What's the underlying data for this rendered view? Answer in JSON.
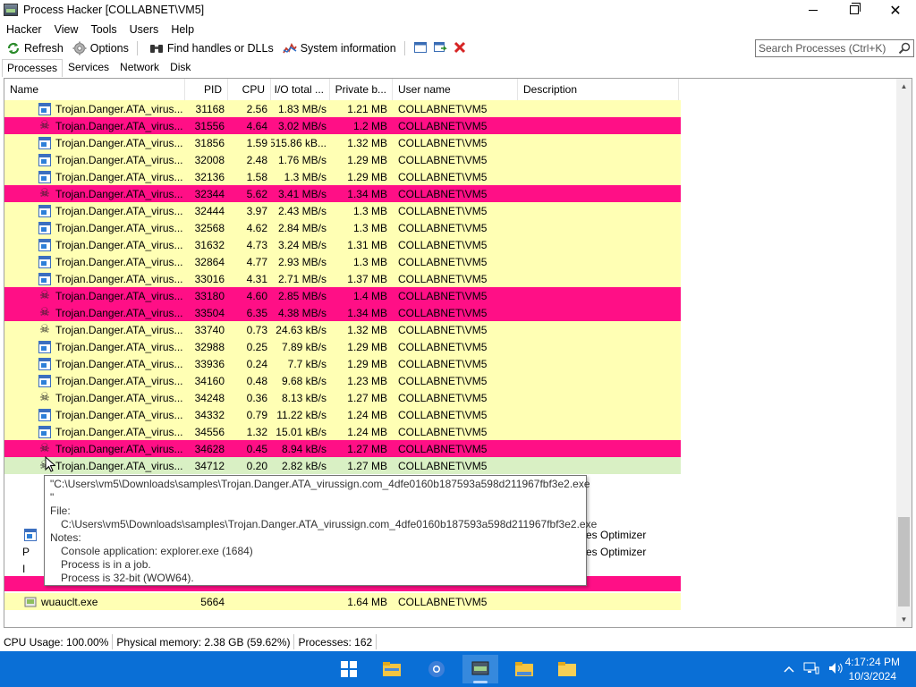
{
  "window": {
    "title": "Process Hacker [COLLABNET\\VM5]"
  },
  "menu": [
    "Hacker",
    "View",
    "Tools",
    "Users",
    "Help"
  ],
  "toolbar": {
    "refresh_label": "Refresh",
    "options_label": "Options",
    "find_label": "Find handles or DLLs",
    "sysinfo_label": "System information",
    "search_placeholder": "Search Processes (Ctrl+K)"
  },
  "tabs": [
    "Processes",
    "Services",
    "Network",
    "Disk"
  ],
  "columns": [
    "Name",
    "PID",
    "CPU",
    "I/O total ...",
    "Private b...",
    "User name",
    "Description"
  ],
  "rows": [
    {
      "name": "Trojan.Danger.ATA_virus...",
      "pid": "31168",
      "cpu": "2.56",
      "io": "1.83 MB/s",
      "priv": "1.21 MB",
      "user": "COLLABNET\\VM5",
      "color": "yellow",
      "icon": "window"
    },
    {
      "name": "Trojan.Danger.ATA_virus...",
      "pid": "31556",
      "cpu": "4.64",
      "io": "3.02 MB/s",
      "priv": "1.2 MB",
      "user": "COLLABNET\\VM5",
      "color": "magenta",
      "icon": "skull"
    },
    {
      "name": "Trojan.Danger.ATA_virus...",
      "pid": "31856",
      "cpu": "1.59",
      "io": "515.86 kB...",
      "priv": "1.32 MB",
      "user": "COLLABNET\\VM5",
      "color": "yellow",
      "icon": "window"
    },
    {
      "name": "Trojan.Danger.ATA_virus...",
      "pid": "32008",
      "cpu": "2.48",
      "io": "1.76 MB/s",
      "priv": "1.29 MB",
      "user": "COLLABNET\\VM5",
      "color": "yellow",
      "icon": "window"
    },
    {
      "name": "Trojan.Danger.ATA_virus...",
      "pid": "32136",
      "cpu": "1.58",
      "io": "1.3 MB/s",
      "priv": "1.29 MB",
      "user": "COLLABNET\\VM5",
      "color": "yellow",
      "icon": "window"
    },
    {
      "name": "Trojan.Danger.ATA_virus...",
      "pid": "32344",
      "cpu": "5.62",
      "io": "3.41 MB/s",
      "priv": "1.34 MB",
      "user": "COLLABNET\\VM5",
      "color": "magenta",
      "icon": "skull"
    },
    {
      "name": "Trojan.Danger.ATA_virus...",
      "pid": "32444",
      "cpu": "3.97",
      "io": "2.43 MB/s",
      "priv": "1.3 MB",
      "user": "COLLABNET\\VM5",
      "color": "yellow",
      "icon": "window"
    },
    {
      "name": "Trojan.Danger.ATA_virus...",
      "pid": "32568",
      "cpu": "4.62",
      "io": "2.84 MB/s",
      "priv": "1.3 MB",
      "user": "COLLABNET\\VM5",
      "color": "yellow",
      "icon": "window"
    },
    {
      "name": "Trojan.Danger.ATA_virus...",
      "pid": "31632",
      "cpu": "4.73",
      "io": "3.24 MB/s",
      "priv": "1.31 MB",
      "user": "COLLABNET\\VM5",
      "color": "yellow",
      "icon": "window"
    },
    {
      "name": "Trojan.Danger.ATA_virus...",
      "pid": "32864",
      "cpu": "4.77",
      "io": "2.93 MB/s",
      "priv": "1.3 MB",
      "user": "COLLABNET\\VM5",
      "color": "yellow",
      "icon": "window"
    },
    {
      "name": "Trojan.Danger.ATA_virus...",
      "pid": "33016",
      "cpu": "4.31",
      "io": "2.71 MB/s",
      "priv": "1.37 MB",
      "user": "COLLABNET\\VM5",
      "color": "yellow",
      "icon": "window"
    },
    {
      "name": "Trojan.Danger.ATA_virus...",
      "pid": "33180",
      "cpu": "4.60",
      "io": "2.85 MB/s",
      "priv": "1.4 MB",
      "user": "COLLABNET\\VM5",
      "color": "magenta",
      "icon": "skull"
    },
    {
      "name": "Trojan.Danger.ATA_virus...",
      "pid": "33504",
      "cpu": "6.35",
      "io": "4.38 MB/s",
      "priv": "1.34 MB",
      "user": "COLLABNET\\VM5",
      "color": "magenta",
      "icon": "skull"
    },
    {
      "name": "Trojan.Danger.ATA_virus...",
      "pid": "33740",
      "cpu": "0.73",
      "io": "24.63 kB/s",
      "priv": "1.32 MB",
      "user": "COLLABNET\\VM5",
      "color": "yellow",
      "icon": "skull"
    },
    {
      "name": "Trojan.Danger.ATA_virus...",
      "pid": "32988",
      "cpu": "0.25",
      "io": "7.89 kB/s",
      "priv": "1.29 MB",
      "user": "COLLABNET\\VM5",
      "color": "yellow",
      "icon": "window"
    },
    {
      "name": "Trojan.Danger.ATA_virus...",
      "pid": "33936",
      "cpu": "0.24",
      "io": "7.7 kB/s",
      "priv": "1.29 MB",
      "user": "COLLABNET\\VM5",
      "color": "yellow",
      "icon": "window"
    },
    {
      "name": "Trojan.Danger.ATA_virus...",
      "pid": "34160",
      "cpu": "0.48",
      "io": "9.68 kB/s",
      "priv": "1.23 MB",
      "user": "COLLABNET\\VM5",
      "color": "yellow",
      "icon": "window"
    },
    {
      "name": "Trojan.Danger.ATA_virus...",
      "pid": "34248",
      "cpu": "0.36",
      "io": "8.13 kB/s",
      "priv": "1.27 MB",
      "user": "COLLABNET\\VM5",
      "color": "yellow",
      "icon": "skull"
    },
    {
      "name": "Trojan.Danger.ATA_virus...",
      "pid": "34332",
      "cpu": "0.79",
      "io": "11.22 kB/s",
      "priv": "1.24 MB",
      "user": "COLLABNET\\VM5",
      "color": "yellow",
      "icon": "window"
    },
    {
      "name": "Trojan.Danger.ATA_virus...",
      "pid": "34556",
      "cpu": "1.32",
      "io": "15.01 kB/s",
      "priv": "1.24 MB",
      "user": "COLLABNET\\VM5",
      "color": "yellow",
      "icon": "window"
    },
    {
      "name": "Trojan.Danger.ATA_virus...",
      "pid": "34628",
      "cpu": "0.45",
      "io": "8.94 kB/s",
      "priv": "1.27 MB",
      "user": "COLLABNET\\VM5",
      "color": "magenta",
      "icon": "skull"
    },
    {
      "name": "Trojan.Danger.ATA_virus...",
      "pid": "34712",
      "cpu": "0.20",
      "io": "2.82 kB/s",
      "priv": "1.27 MB",
      "user": "COLLABNET\\VM5",
      "color": "green",
      "icon": "skull"
    }
  ],
  "partial_rows": {
    "desc_1": "es Optimizer",
    "desc_2": "es Optimizer",
    "row_a": "a",
    "row_p": "P",
    "row_i": "I"
  },
  "last_row": {
    "name": "wuauclt.exe",
    "pid": "5664",
    "priv": "1.64 MB",
    "user": "COLLABNET\\VM5"
  },
  "tooltip": {
    "line1": "\"C:\\Users\\vm5\\Downloads\\samples\\Trojan.Danger.ATA_virussign.com_4dfe0160b187593a598d211967fbf3e2.exe",
    "line2": "\"",
    "file_label": "File:",
    "file_path": "C:\\Users\\vm5\\Downloads\\samples\\Trojan.Danger.ATA_virussign.com_4dfe0160b187593a598d211967fbf3e2.exe",
    "notes_label": "Notes:",
    "note1": "Console application: explorer.exe (1684)",
    "note2": "Process is in a job.",
    "note3": "Process is 32-bit (WOW64)."
  },
  "statusbar": {
    "cpu": "CPU Usage: 100.00%",
    "memory": "Physical memory: 2.38 GB (59.62%)",
    "processes": "Processes: 162"
  },
  "clock": {
    "time": "4:17:24 PM",
    "date": "10/3/2024"
  },
  "colors": {
    "highlight_yellow": "#ffffb4",
    "highlight_magenta": "#ff0f86",
    "selected_green": "#d9f0c4",
    "taskbar": "#0a6fd6"
  }
}
